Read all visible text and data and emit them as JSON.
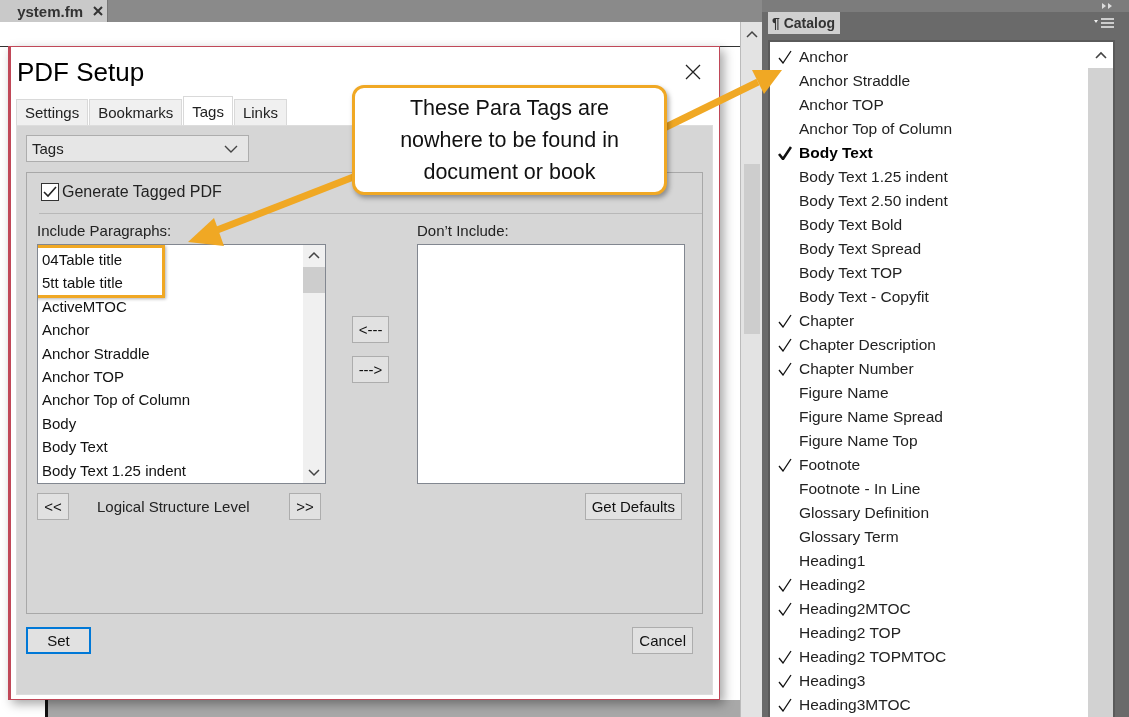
{
  "document_tab": {
    "title": "ystem.fm"
  },
  "dialog": {
    "title": "PDF Setup",
    "tabs": [
      {
        "label": "Settings",
        "selected": false
      },
      {
        "label": "Bookmarks",
        "selected": false
      },
      {
        "label": "Tags",
        "selected": true
      },
      {
        "label": "Links",
        "selected": false
      }
    ],
    "dropdown": {
      "value": "Tags"
    },
    "generate_tagged_pdf": {
      "label": "Generate Tagged PDF",
      "checked": true
    },
    "include": {
      "label": "Include Paragraphs:",
      "items": [
        {
          "label": "04Table title",
          "flagged": true
        },
        {
          "label": "5tt table title",
          "flagged": true
        },
        {
          "label": "ActiveMTOC",
          "flagged": false
        },
        {
          "label": "Anchor",
          "flagged": false
        },
        {
          "label": "Anchor Straddle",
          "flagged": false
        },
        {
          "label": "Anchor TOP",
          "flagged": false
        },
        {
          "label": "Anchor Top of Column",
          "flagged": false
        },
        {
          "label": "Body",
          "flagged": false
        },
        {
          "label": "Body Text",
          "flagged": false
        },
        {
          "label": "Body Text 1.25 indent",
          "flagged": false
        }
      ]
    },
    "move_buttons": [
      "<---",
      "--->"
    ],
    "exclude": {
      "label": "Don’t Include:"
    },
    "level_buttons": [
      "<<",
      ">>"
    ],
    "level_label": "Logical Structure Level",
    "get_defaults": "Get Defaults",
    "set_button": "Set",
    "cancel_button": "Cancel"
  },
  "catalog": {
    "title": "¶ Catalog",
    "items": [
      {
        "label": "Anchor",
        "checked": true,
        "current": false
      },
      {
        "label": "Anchor Straddle",
        "checked": false,
        "current": false
      },
      {
        "label": "Anchor TOP",
        "checked": false,
        "current": false
      },
      {
        "label": "Anchor Top of Column",
        "checked": false,
        "current": false
      },
      {
        "label": "Body Text",
        "checked": true,
        "current": true
      },
      {
        "label": "Body Text 1.25 indent",
        "checked": false,
        "current": false
      },
      {
        "label": "Body Text 2.50 indent",
        "checked": false,
        "current": false
      },
      {
        "label": "Body Text Bold",
        "checked": false,
        "current": false
      },
      {
        "label": "Body Text Spread",
        "checked": false,
        "current": false
      },
      {
        "label": "Body Text TOP",
        "checked": false,
        "current": false
      },
      {
        "label": "Body Text - Copyfit",
        "checked": false,
        "current": false
      },
      {
        "label": "Chapter",
        "checked": true,
        "current": false
      },
      {
        "label": "Chapter Description",
        "checked": true,
        "current": false
      },
      {
        "label": "Chapter Number",
        "checked": true,
        "current": false
      },
      {
        "label": "Figure Name",
        "checked": false,
        "current": false
      },
      {
        "label": "Figure Name Spread",
        "checked": false,
        "current": false
      },
      {
        "label": "Figure Name Top",
        "checked": false,
        "current": false
      },
      {
        "label": "Footnote",
        "checked": true,
        "current": false
      },
      {
        "label": "Footnote - In Line",
        "checked": false,
        "current": false
      },
      {
        "label": "Glossary Definition",
        "checked": false,
        "current": false
      },
      {
        "label": "Glossary Term",
        "checked": false,
        "current": false
      },
      {
        "label": "Heading1",
        "checked": false,
        "current": false
      },
      {
        "label": "Heading2",
        "checked": true,
        "current": false
      },
      {
        "label": "Heading2MTOC",
        "checked": true,
        "current": false
      },
      {
        "label": "Heading2 TOP",
        "checked": false,
        "current": false
      },
      {
        "label": "Heading2 TOPMTOC",
        "checked": true,
        "current": false
      },
      {
        "label": "Heading3",
        "checked": true,
        "current": false
      },
      {
        "label": "Heading3MTOC",
        "checked": true,
        "current": false
      }
    ]
  },
  "callout": {
    "text": "These Para Tags are nowhere to be found in document or book"
  }
}
